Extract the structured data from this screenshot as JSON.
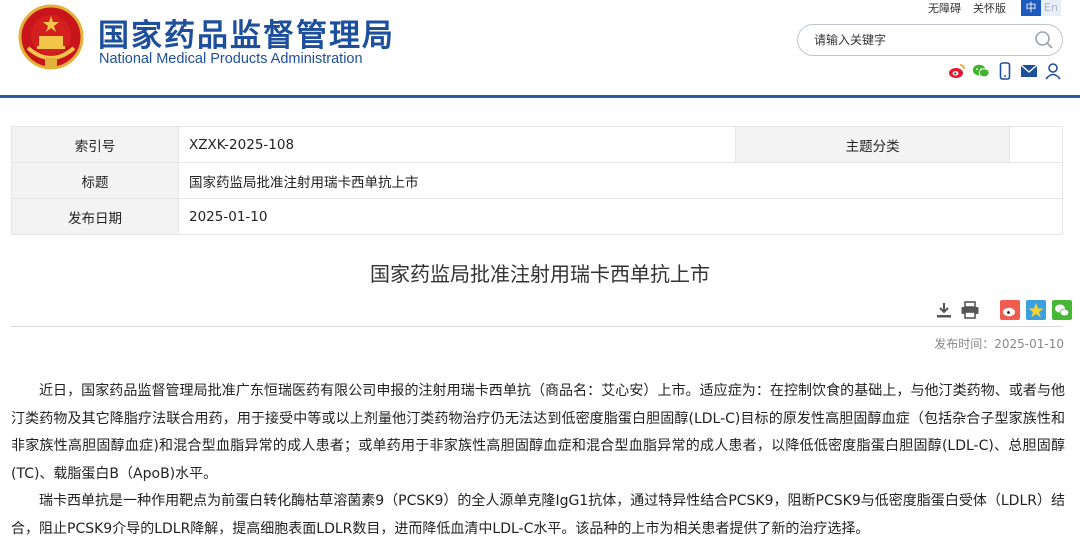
{
  "header": {
    "title_cn": "国家药品监督管理局",
    "title_en": "National Medical Products Administration",
    "links": [
      "无障碍",
      "关怀版"
    ],
    "lang": {
      "zh": "中",
      "en": "En"
    },
    "search": {
      "placeholder": "请输入关键字"
    },
    "social_icons": [
      "weibo-icon",
      "wechat-icon",
      "mobile-icon",
      "mail-icon",
      "user-icon"
    ]
  },
  "info": {
    "index_label": "索引号",
    "index_value": "XZXK-2025-108",
    "category_label": "主题分类",
    "category_value": "",
    "title_label": "标题",
    "title_value": "国家药监局批准注射用瑞卡西单抗上市",
    "date_label": "发布日期",
    "date_value": "2025-01-10"
  },
  "article": {
    "title": "国家药监局批准注射用瑞卡西单抗上市",
    "publish": "发布时间：2025-01-10",
    "paragraphs": [
      "近日，国家药品监督管理局批准广东恒瑞医药有限公司申报的注射用瑞卡西单抗（商品名：艾心安）上市。适应症为：在控制饮食的基础上，与他汀类药物、或者与他汀类药物及其它降脂疗法联合用药，用于接受中等或以上剂量他汀类药物治疗仍无法达到低密度脂蛋白胆固醇(LDL-C)目标的原发性高胆固醇血症（包括杂合子型家族性和非家族性高胆固醇血症)和混合型血脂异常的成人患者；或单药用于非家族性高胆固醇血症和混合型血脂异常的成人患者，以降低低密度脂蛋白胆固醇(LDL-C)、总胆固醇(TC)、载脂蛋白B（ApoB)水平。",
      "瑞卡西单抗是一种作用靶点为前蛋白转化酶枯草溶菌素9（PCSK9）的全人源单克隆IgG1抗体，通过特异性结合PCSK9，阻断PCSK9与低密度脂蛋白受体（LDLR）结合，阻止PCSK9介导的LDLR降解，提高细胞表面LDLR数目，进而降低血清中LDL-C水平。该品种的上市为相关患者提供了新的治疗选择。"
    ]
  },
  "colors": {
    "brand": "#1e4f9c",
    "rule": "#2a5aa8",
    "weibo": "#e6162d",
    "wechat": "#3fb42a"
  }
}
